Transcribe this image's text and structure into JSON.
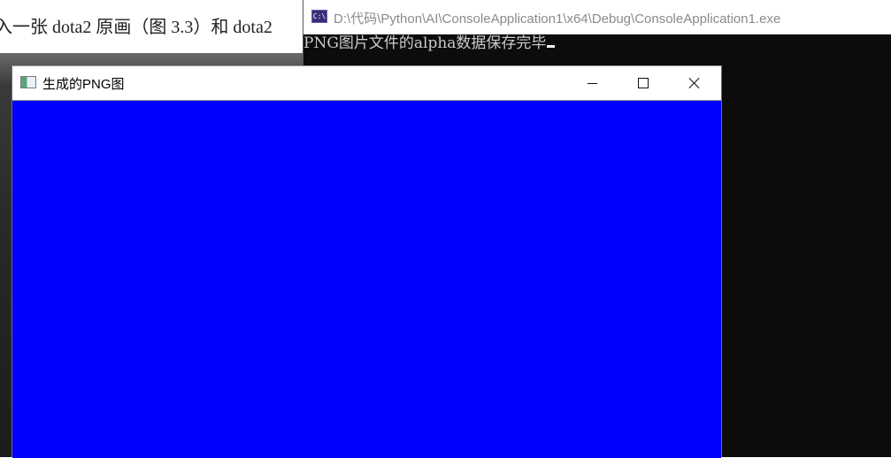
{
  "background_document": {
    "text": "入一张 dota2 原画（图 3.3）和 dota2"
  },
  "console_window": {
    "icon": "console-app-icon",
    "icon_text": "C:\\",
    "title": "D:\\代码\\Python\\AI\\ConsoleApplication1\\x64\\Debug\\ConsoleApplication1.exe",
    "output": "PNG图片文件的alpha数据保存完毕"
  },
  "viewer_window": {
    "icon": "image-window-icon",
    "title": "生成的PNG图",
    "buttons": {
      "minimize": "minimize-icon",
      "maximize": "maximize-icon",
      "close": "close-icon"
    },
    "canvas_color": "#0000ff"
  }
}
